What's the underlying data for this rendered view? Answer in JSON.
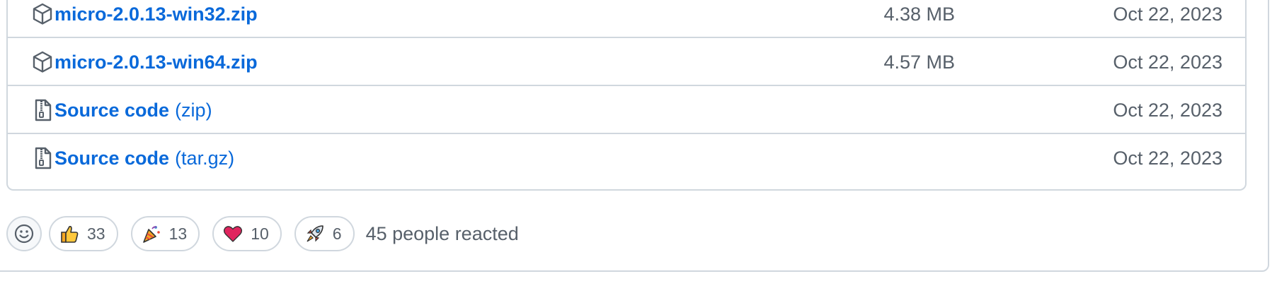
{
  "assets": [
    {
      "icon": "package-icon",
      "name": "micro-2.0.13-win32.zip",
      "suffix": "",
      "size": "4.38 MB",
      "date": "Oct 22, 2023"
    },
    {
      "icon": "package-icon",
      "name": "micro-2.0.13-win64.zip",
      "suffix": "",
      "size": "4.57 MB",
      "date": "Oct 22, 2023"
    },
    {
      "icon": "file-zip-icon",
      "name": "Source code",
      "suffix": "(zip)",
      "size": "",
      "date": "Oct 22, 2023"
    },
    {
      "icon": "file-zip-icon",
      "name": "Source code",
      "suffix": "(tar.gz)",
      "size": "",
      "date": "Oct 22, 2023"
    }
  ],
  "reactions": {
    "items": [
      {
        "icon": "thumbs-up-icon",
        "count": "33"
      },
      {
        "icon": "party-popper-icon",
        "count": "13"
      },
      {
        "icon": "heart-icon",
        "count": "10"
      },
      {
        "icon": "rocket-icon",
        "count": "6"
      }
    ],
    "summary": "45 people reacted"
  },
  "colors": {
    "link": "#0969da",
    "muted": "#57606a",
    "border": "#d0d7de"
  }
}
